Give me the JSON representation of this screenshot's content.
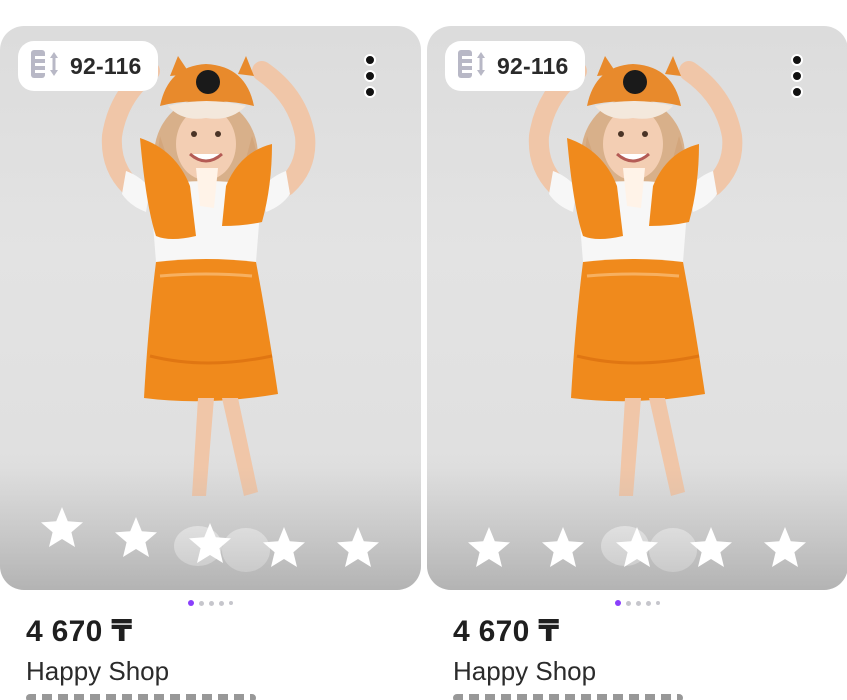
{
  "products": [
    {
      "size_label": "92-116",
      "price": "4 670 ₸",
      "shop_name": "Happy Shop",
      "rating_stars": 5,
      "gallery_pages": 5,
      "gallery_active": 1
    },
    {
      "size_label": "92-116",
      "price": "4 670 ₸",
      "shop_name": "Happy Shop",
      "rating_stars": 5,
      "gallery_pages": 5,
      "gallery_active": 1
    }
  ],
  "icons": {
    "size": "size-ruler-icon",
    "menu": "more-vertical-icon",
    "star": "star-outline-icon"
  },
  "colors": {
    "accent": "#8a3ffc",
    "costume_orange": "#f08a1c",
    "background_photo": "#e0e0e0"
  }
}
